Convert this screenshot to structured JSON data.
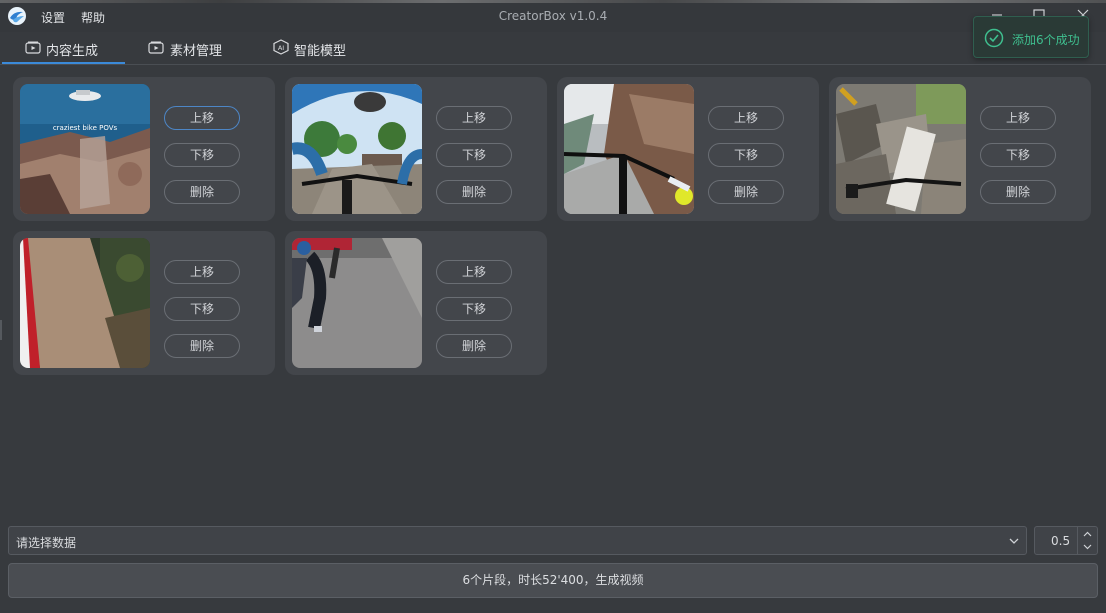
{
  "window": {
    "title": "CreatorBox v1.0.4",
    "menu": [
      "设置",
      "帮助"
    ]
  },
  "toast": {
    "message": "添加6个成功",
    "icon": "check-circle-icon",
    "color": "#3fbf8f"
  },
  "tabs": [
    {
      "label": "内容生成",
      "icon": "play-screen-icon",
      "active": true
    },
    {
      "label": "素材管理",
      "icon": "play-screen-icon",
      "active": false
    },
    {
      "label": "智能模型",
      "icon": "ai-icon",
      "active": false
    }
  ],
  "clips": [
    {
      "thumbnail_caption": "craziest bike POVs",
      "buttons": {
        "up": "上移",
        "down": "下移",
        "delete": "删除"
      }
    },
    {
      "buttons": {
        "up": "上移",
        "down": "下移",
        "delete": "删除"
      }
    },
    {
      "buttons": {
        "up": "上移",
        "down": "下移",
        "delete": "删除"
      }
    },
    {
      "buttons": {
        "up": "上移",
        "down": "下移",
        "delete": "删除"
      }
    },
    {
      "buttons": {
        "up": "上移",
        "down": "下移",
        "delete": "删除"
      }
    },
    {
      "buttons": {
        "up": "上移",
        "down": "下移",
        "delete": "删除"
      }
    }
  ],
  "data_select": {
    "placeholder": "请选择数据",
    "icon": "chevron-down-icon"
  },
  "spinbox": {
    "value": "0.5"
  },
  "generate_button": {
    "label": "6个片段，时长52'400，生成视频"
  },
  "colors": {
    "accent": "#3b8ad9",
    "background": "#373a3e",
    "card": "#43464b"
  }
}
